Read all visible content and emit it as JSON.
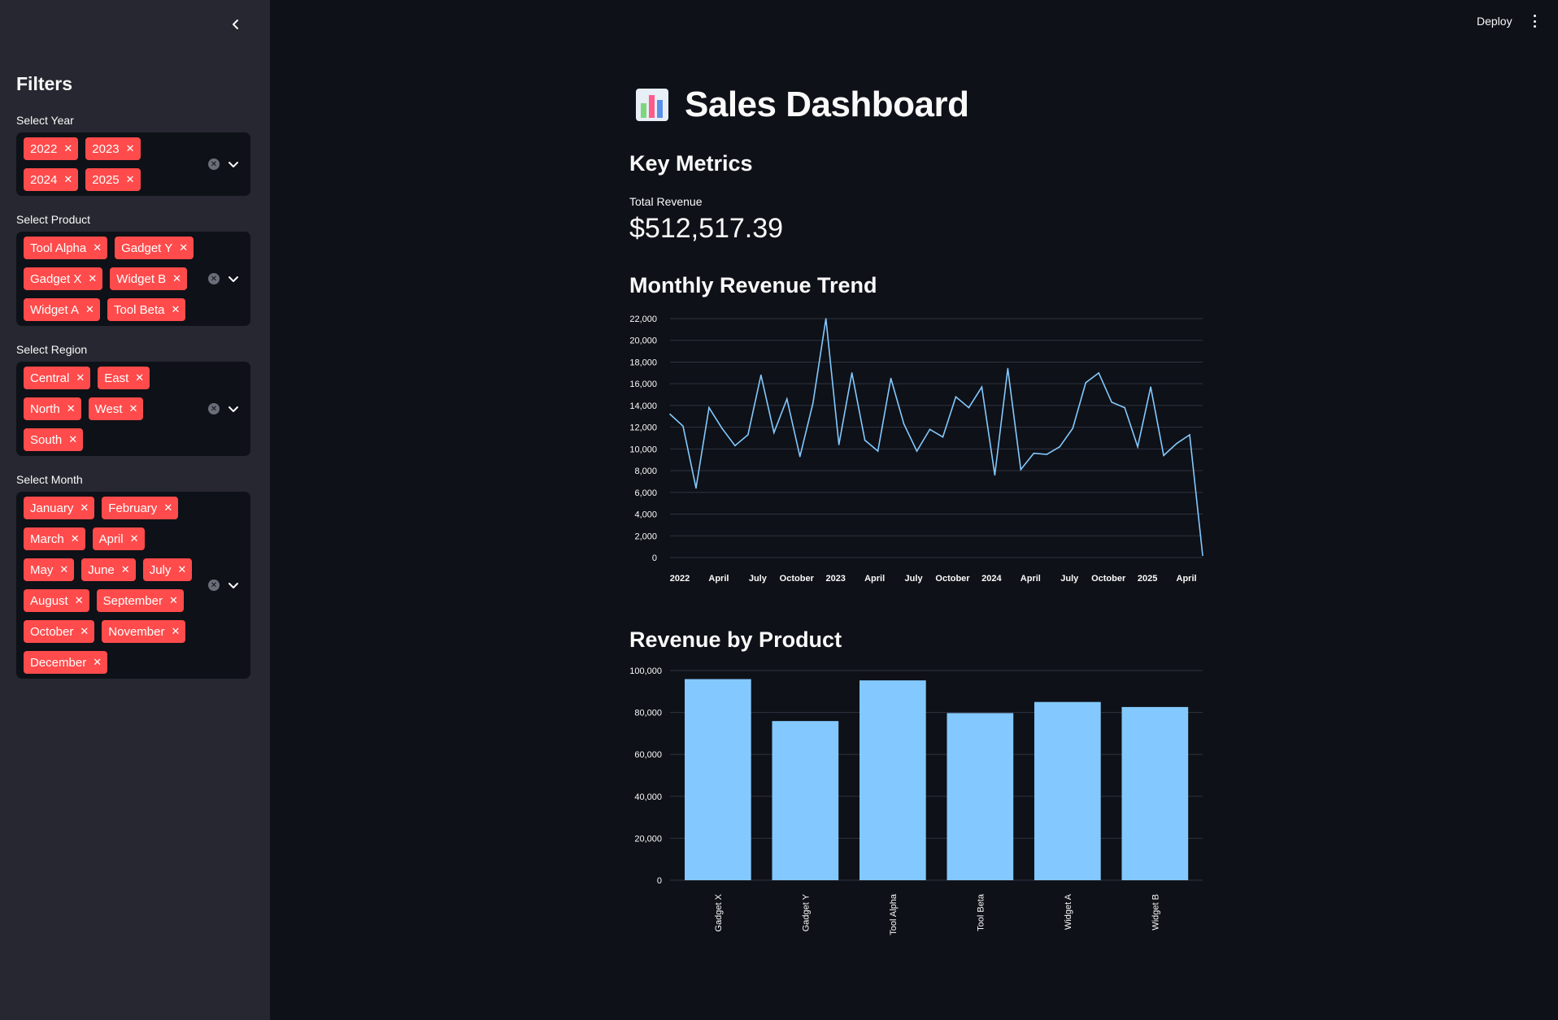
{
  "sidebar": {
    "title": "Filters",
    "filters": [
      {
        "label": "Select Year",
        "options": [
          "2022",
          "2023",
          "2024",
          "2025"
        ]
      },
      {
        "label": "Select Product",
        "options": [
          "Tool Alpha",
          "Gadget Y",
          "Gadget X",
          "Widget B",
          "Widget A",
          "Tool Beta"
        ]
      },
      {
        "label": "Select Region",
        "options": [
          "Central",
          "East",
          "North",
          "West",
          "South"
        ]
      },
      {
        "label": "Select Month",
        "options": [
          "January",
          "February",
          "March",
          "April",
          "May",
          "June",
          "July",
          "August",
          "September",
          "October",
          "November",
          "December"
        ]
      }
    ]
  },
  "header": {
    "deploy_label": "Deploy"
  },
  "main": {
    "title": "Sales Dashboard",
    "key_metrics_heading": "Key Metrics",
    "metric": {
      "label": "Total Revenue",
      "value": "$512,517.39"
    },
    "trend_heading": "Monthly Revenue Trend",
    "product_heading": "Revenue by Product"
  },
  "colors": {
    "accent": "#ff4b4b",
    "series": "#83c9ff",
    "background": "#0e1117",
    "sidebar": "#262730"
  },
  "chart_data": [
    {
      "type": "line",
      "title": "Monthly Revenue Trend",
      "x": [
        "2022-01",
        "2022-02",
        "2022-03",
        "2022-04",
        "2022-05",
        "2022-06",
        "2022-07",
        "2022-08",
        "2022-09",
        "2022-10",
        "2022-11",
        "2022-12",
        "2023-01",
        "2023-02",
        "2023-03",
        "2023-04",
        "2023-05",
        "2023-06",
        "2023-07",
        "2023-08",
        "2023-09",
        "2023-10",
        "2023-11",
        "2023-12",
        "2024-01",
        "2024-02",
        "2024-03",
        "2024-04",
        "2024-05",
        "2024-06",
        "2024-07",
        "2024-08",
        "2024-09",
        "2024-10",
        "2024-11",
        "2024-12",
        "2025-01",
        "2025-02",
        "2025-03",
        "2025-04",
        "2025-05",
        "2025-06"
      ],
      "values": [
        13200,
        12100,
        6400,
        13800,
        11900,
        10300,
        11300,
        16800,
        11500,
        14600,
        9300,
        14200,
        22000,
        10400,
        17000,
        10800,
        9800,
        16500,
        12300,
        9800,
        11800,
        11100,
        14800,
        13800,
        15700,
        7600,
        17400,
        8100,
        9600,
        9500,
        10200,
        11900,
        16100,
        17000,
        14300,
        13800,
        10200,
        15700,
        9400,
        10500,
        11300,
        200
      ],
      "x_tick_labels": [
        "2022",
        "April",
        "July",
        "October",
        "2023",
        "April",
        "July",
        "October",
        "2024",
        "April",
        "July",
        "October",
        "2025",
        "April"
      ],
      "y_ticks": [
        "0",
        "2,000",
        "4,000",
        "6,000",
        "8,000",
        "10,000",
        "12,000",
        "14,000",
        "16,000",
        "18,000",
        "20,000",
        "22,000"
      ],
      "ylim": [
        0,
        22000
      ],
      "grid": true
    },
    {
      "type": "bar",
      "title": "Revenue by Product",
      "categories": [
        "Gadget X",
        "Gadget Y",
        "Tool Alpha",
        "Tool Beta",
        "Widget A",
        "Widget B"
      ],
      "values": [
        95900,
        75900,
        95300,
        79700,
        85000,
        82600
      ],
      "y_ticks": [
        "0",
        "20,000",
        "40,000",
        "60,000",
        "80,000",
        "100,000"
      ],
      "ylim": [
        0,
        100000
      ],
      "grid": true
    }
  ]
}
